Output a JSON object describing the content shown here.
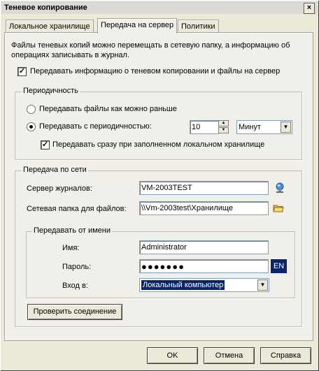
{
  "window": {
    "title": "Теневое копирование",
    "close_glyph": "×"
  },
  "tabs": [
    {
      "label": "Локальное хранилище",
      "active": false
    },
    {
      "label": "Передача на сервер",
      "active": true
    },
    {
      "label": "Политики",
      "active": false
    }
  ],
  "description": "Файлы теневых копий можно перемещать в сетевую папку, а информацию об операциях записывать в журнал.",
  "main_checkbox": {
    "label": "Передавать информацию о теневом копировании и файлы на сервер",
    "checked": true
  },
  "periodicity": {
    "label": "Периодичность",
    "radio_asap": {
      "label": "Передавать файлы как можно раньше",
      "selected": false
    },
    "radio_periodic": {
      "label": "Передавать с периодичностью:",
      "selected": true
    },
    "interval_value": "10",
    "unit_value": "Минут",
    "full_storage_checkbox": {
      "label": "Передавать сразу при заполненном локальном хранилище",
      "checked": true
    }
  },
  "network": {
    "label": "Передача по сети",
    "log_server_label": "Сервер журналов:",
    "log_server_value": "VM-2003TEST",
    "share_label": "Сетевая папка для файлов:",
    "share_value": "\\\\Vm-2003test\\Хранилище",
    "impersonate": {
      "label": "Передавать от имени",
      "name_label": "Имя:",
      "name_value": "Administrator",
      "password_label": "Пароль:",
      "password_value": "●●●●●●●",
      "lang_badge": "EN",
      "login_label": "Вход в:",
      "login_value": "Локальный компьютер"
    },
    "test_button": "Проверить соединение"
  },
  "footer": {
    "ok": "OK",
    "cancel": "Отмена",
    "help": "Справка"
  },
  "colors": {
    "lang_badge_bg": "#0a246a",
    "selection_bg": "#0a246a"
  },
  "icons": {
    "server": "server-browse-icon",
    "folder": "folder-browse-icon"
  }
}
